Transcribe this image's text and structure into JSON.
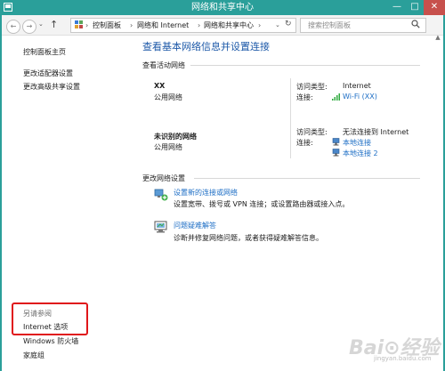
{
  "window": {
    "title": "网络和共享中心",
    "min": "—",
    "max": "□",
    "close": "✕"
  },
  "nav": {
    "back": "←",
    "forward": "→",
    "recent": "⌄",
    "up": "↑",
    "breadcrumbs": [
      "控制面板",
      "网络和 Internet",
      "网络和共享中心"
    ],
    "separator": "›",
    "dropdown": "⌄",
    "refresh": "↻",
    "search_placeholder": "搜索控制面板"
  },
  "sidebar": {
    "home": "控制面板主页",
    "adapter": "更改适配器设置",
    "advanced": "更改高级共享设置",
    "see_also": "另请参阅",
    "links": [
      "Internet 选项",
      "Windows 防火墙",
      "家庭组"
    ]
  },
  "main": {
    "heading": "查看基本网络信息并设置连接",
    "active_title": "查看活动网络",
    "networks": [
      {
        "name": "XX",
        "type": "公用网络",
        "access_label": "访问类型:",
        "access_value": "Internet",
        "conn_label": "连接:",
        "connections": [
          "Wi-Fi (XX)"
        ]
      },
      {
        "name": "未识别的网络",
        "type": "公用网络",
        "access_label": "访问类型:",
        "access_value": "无法连接到 Internet",
        "conn_label": "连接:",
        "connections": [
          "本地连接",
          "本地连接 2"
        ]
      }
    ],
    "change_title": "更改网络设置",
    "actions": [
      {
        "link": "设置新的连接或网络",
        "desc": "设置宽带、拨号或 VPN 连接；或设置路由器或接入点。"
      },
      {
        "link": "问题疑难解答",
        "desc": "诊断并修复网络问题，或者获得疑难解答信息。"
      }
    ]
  },
  "watermark": {
    "brand": "Bai⊙经验",
    "sub": "jingyan.baidu.com"
  },
  "colors": {
    "titlebar": "#2a9f9a",
    "heading": "#1d59a8",
    "link": "#1d6ec5",
    "highlight_box": "#e0161a",
    "close": "#c7504c"
  }
}
